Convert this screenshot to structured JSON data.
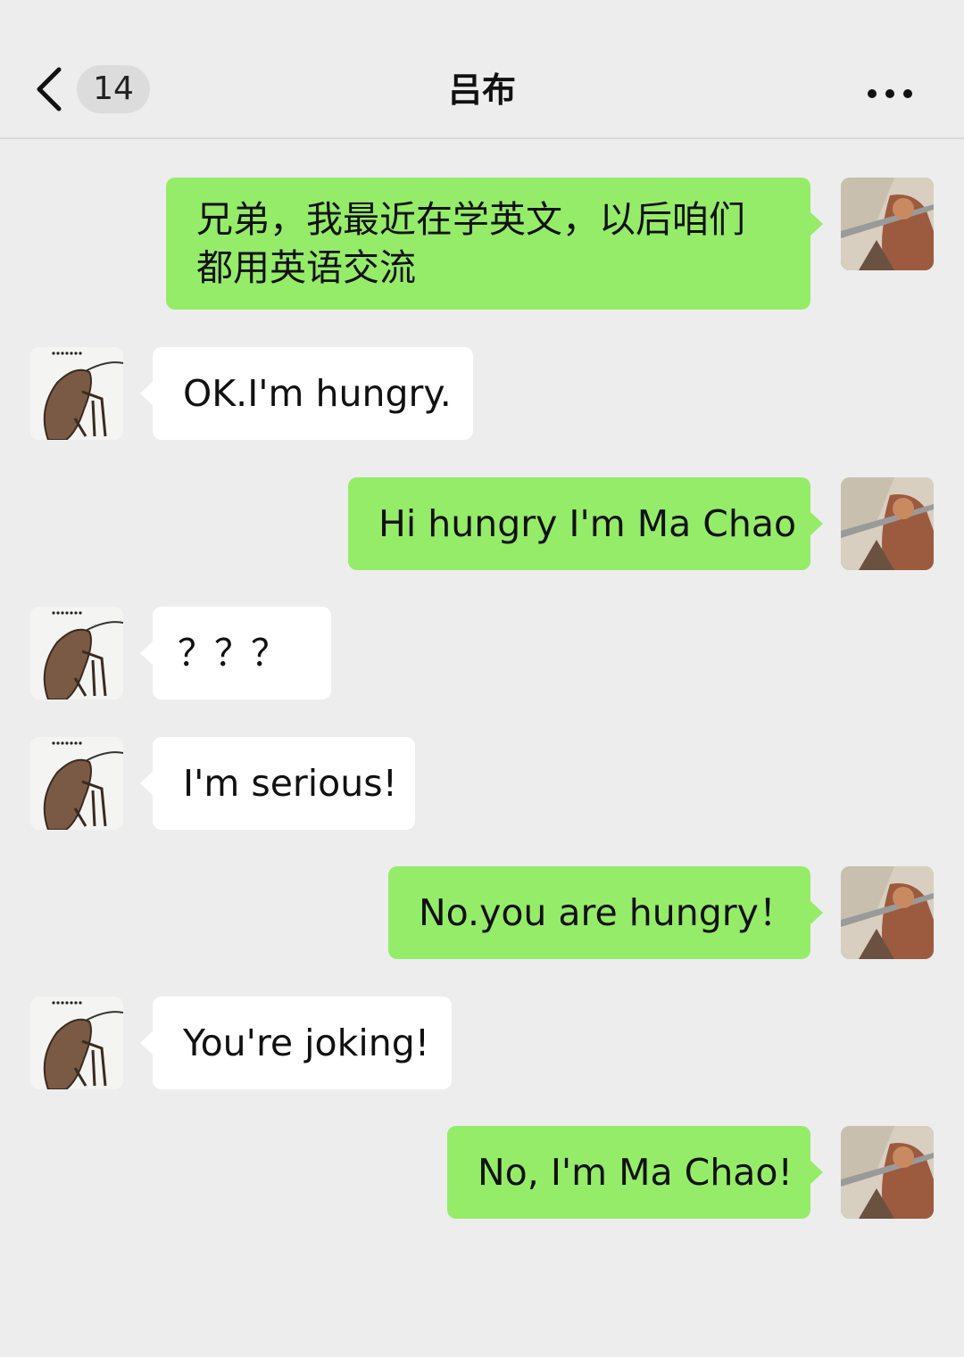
{
  "header": {
    "unread_count": "14",
    "title": "吕布"
  },
  "colors": {
    "background": "#ededed",
    "my_bubble": "#95ec69",
    "their_bubble": "#ffffff"
  },
  "icons": {
    "back": "chevron-left-icon",
    "more": "more-dots-icon"
  },
  "messages": [
    {
      "sender": "me",
      "text": "兄弟，我最近在学英文，以后咱们都用英语交流"
    },
    {
      "sender": "them",
      "text": "OK.I'm hungry."
    },
    {
      "sender": "me",
      "text": "Hi hungry I'm Ma Chao"
    },
    {
      "sender": "them",
      "text": "？？？"
    },
    {
      "sender": "them",
      "text": "I'm serious!"
    },
    {
      "sender": "me",
      "text": "No.you are hungry！"
    },
    {
      "sender": "them",
      "text": "You're joking!"
    },
    {
      "sender": "me",
      "text": "No, I'm Ma Chao!"
    }
  ]
}
